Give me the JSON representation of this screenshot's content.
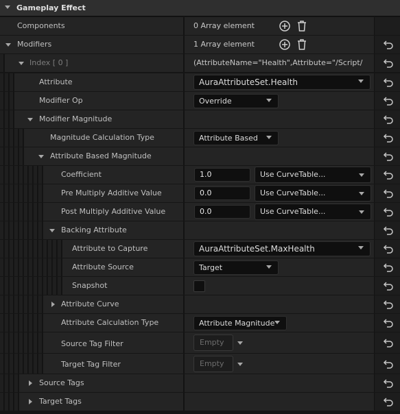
{
  "section": {
    "title": "Gameplay Effect"
  },
  "rows": {
    "components": {
      "label": "Components",
      "value": "0 Array element"
    },
    "modifiers": {
      "label": "Modifiers",
      "value": "1 Array element"
    },
    "index0": {
      "label": "Index [ 0 ]",
      "value": "(AttributeName=\"Health\",Attribute=\"/Script/"
    },
    "attribute": {
      "label": "Attribute",
      "value": "AuraAttributeSet.Health"
    },
    "modifier_op": {
      "label": "Modifier Op",
      "value": "Override"
    },
    "modifier_magnitude": {
      "label": "Modifier Magnitude"
    },
    "magnitude_calc_type": {
      "label": "Magnitude Calculation Type",
      "value": "Attribute Based"
    },
    "attribute_based_magnitude": {
      "label": "Attribute Based Magnitude"
    },
    "coefficient": {
      "label": "Coefficient",
      "value": "1.0",
      "curve": "Use CurveTable..."
    },
    "pre_multiply": {
      "label": "Pre Multiply Additive Value",
      "value": "0.0",
      "curve": "Use CurveTable..."
    },
    "post_multiply": {
      "label": "Post Multiply Additive Value",
      "value": "0.0",
      "curve": "Use CurveTable..."
    },
    "backing_attribute": {
      "label": "Backing Attribute"
    },
    "attribute_to_capture": {
      "label": "Attribute to Capture",
      "value": "AuraAttributeSet.MaxHealth"
    },
    "attribute_source": {
      "label": "Attribute Source",
      "value": "Target"
    },
    "snapshot": {
      "label": "Snapshot",
      "checked": false
    },
    "attribute_curve": {
      "label": "Attribute Curve"
    },
    "attribute_calc_type": {
      "label": "Attribute Calculation Type",
      "value": "Attribute Magnitude"
    },
    "source_tag_filter": {
      "label": "Source Tag Filter",
      "value": "Empty"
    },
    "target_tag_filter": {
      "label": "Target Tag Filter",
      "value": "Empty"
    },
    "source_tags": {
      "label": "Source Tags"
    },
    "target_tags": {
      "label": "Target Tags"
    }
  },
  "icons": {
    "add": "plus-circle-icon",
    "delete": "trash-icon",
    "reset": "reset-arrow-icon",
    "expand": "chevron-down-icon",
    "collapse": "chevron-right-icon"
  },
  "colors": {
    "background": "#151515",
    "row": "#242424",
    "input": "#0f0f0f",
    "text": "#c0c0c0",
    "dim_text": "#7d7d7d"
  }
}
